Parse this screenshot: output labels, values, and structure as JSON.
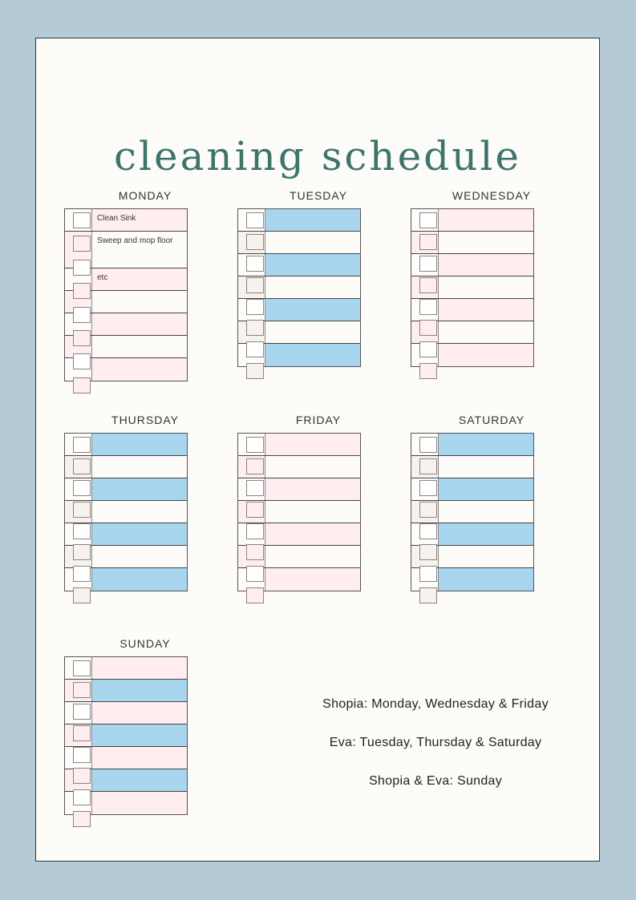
{
  "title": "cleaning schedule",
  "colors": {
    "background": "#b4cad7",
    "page": "#fdfcf9",
    "title": "#3b756c",
    "pink": "#ffedf0",
    "blue": "#a9d6ef",
    "tint_pink": "#ffedf0",
    "tint_beige": "#f7f2ee"
  },
  "days": [
    {
      "name": "MONDAY",
      "scheme": "pink",
      "tasks": [
        "Clean Sink",
        "Sweep and mop floor",
        "etc",
        "",
        "",
        "",
        ""
      ]
    },
    {
      "name": "TUESDAY",
      "scheme": "blue",
      "tasks": [
        "",
        "",
        "",
        "",
        "",
        "",
        ""
      ]
    },
    {
      "name": "WEDNESDAY",
      "scheme": "pink",
      "tasks": [
        "",
        "",
        "",
        "",
        "",
        "",
        ""
      ]
    },
    {
      "name": "THURSDAY",
      "scheme": "blue",
      "tasks": [
        "",
        "",
        "",
        "",
        "",
        "",
        ""
      ]
    },
    {
      "name": "FRIDAY",
      "scheme": "pink",
      "tasks": [
        "",
        "",
        "",
        "",
        "",
        "",
        ""
      ]
    },
    {
      "name": "SATURDAY",
      "scheme": "blue",
      "tasks": [
        "",
        "",
        "",
        "",
        "",
        "",
        ""
      ]
    },
    {
      "name": "SUNDAY",
      "scheme": "mixed",
      "tasks": [
        "",
        "",
        "",
        "",
        "",
        "",
        ""
      ]
    }
  ],
  "assignments": [
    "Shopia: Monday, Wednesday & Friday",
    "Eva: Tuesday, Thursday & Saturday",
    "Shopia & Eva: Sunday"
  ]
}
